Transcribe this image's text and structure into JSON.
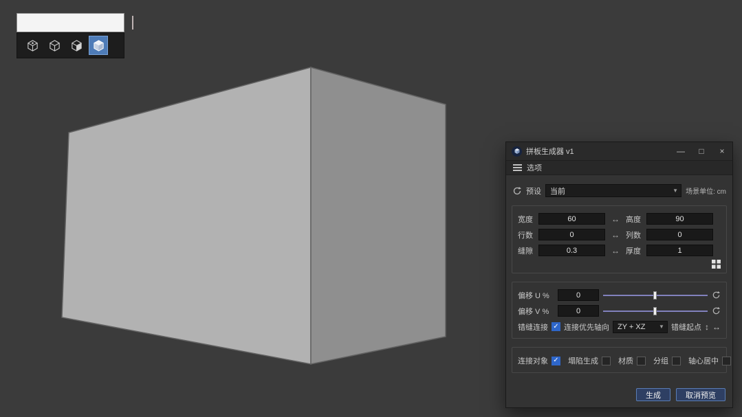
{
  "toolbar": {
    "search": {
      "value": "",
      "placeholder": ""
    },
    "buttons": [
      {
        "name": "cube-dot"
      },
      {
        "name": "cube-outline"
      },
      {
        "name": "cube-half-shaded"
      },
      {
        "name": "cube-solid",
        "selected": true
      }
    ]
  },
  "viewport": {
    "background": "#3b3b3b",
    "object": "box",
    "box_colors": {
      "left_face": "#b2b2b2",
      "right_face": "#8f8f8f",
      "edge": "#626262"
    }
  },
  "dialog": {
    "title": "拼板生成器 v1",
    "window_controls": {
      "minimize": "—",
      "maximize": "□",
      "close": "×"
    },
    "menu": {
      "options": "选项"
    },
    "preset": {
      "label": "预设",
      "value": "当前",
      "units": "场景单位: cm"
    },
    "dims": {
      "width": {
        "label": "宽度",
        "value": "60"
      },
      "height": {
        "label": "高度",
        "value": "90"
      },
      "rows": {
        "label": "行数",
        "value": "0"
      },
      "cols": {
        "label": "列数",
        "value": "0"
      },
      "gap": {
        "label": "缝隙",
        "value": "0.3"
      },
      "thickness": {
        "label": "厚度",
        "value": "1"
      }
    },
    "offset": {
      "u": {
        "label": "偏移 U %",
        "value": "0"
      },
      "v": {
        "label": "偏移 V %",
        "value": "0"
      },
      "stagger": {
        "label": "错缝连接",
        "checked": true
      },
      "axis": {
        "label": "连接优先轴向",
        "value": "ZY + XZ"
      },
      "start": {
        "label": "错缝起点"
      }
    },
    "options": {
      "connect": {
        "label": "连接对象",
        "checked": true
      },
      "collapse": {
        "label": "塌陷生成",
        "checked": false
      },
      "material": {
        "label": "材质",
        "checked": false
      },
      "group": {
        "label": "分组",
        "checked": false
      },
      "pivot": {
        "label": "轴心居中",
        "checked": false
      }
    },
    "actions": {
      "generate": "生成",
      "cancel": "取消预览"
    }
  }
}
